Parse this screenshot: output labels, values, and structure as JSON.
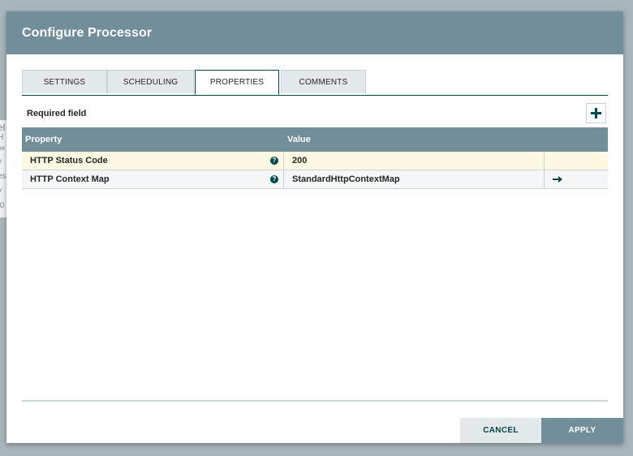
{
  "background": {
    "fragments": [
      "el",
      "H",
      "he",
      "y",
      "es",
      "y",
      ":0"
    ]
  },
  "dialog": {
    "title": "Configure Processor"
  },
  "tabs": [
    {
      "label": "SETTINGS",
      "active": false
    },
    {
      "label": "SCHEDULING",
      "active": false
    },
    {
      "label": "PROPERTIES",
      "active": true
    },
    {
      "label": "COMMENTS",
      "active": false
    }
  ],
  "properties": {
    "required_label": "Required field",
    "add_icon": "plus-icon",
    "columns": {
      "property": "Property",
      "value": "Value"
    },
    "rows": [
      {
        "name": "HTTP Status Code",
        "value": "200",
        "help_icon": "?",
        "action_icon": ""
      },
      {
        "name": "HTTP Context Map",
        "value": "StandardHttpContextMap",
        "help_icon": "?",
        "action_icon": "arrow-right-icon"
      }
    ]
  },
  "footer": {
    "cancel_label": "CANCEL",
    "apply_label": "APPLY"
  },
  "colors": {
    "header_bg": "#728e9b",
    "accent": "#004849",
    "required_row_bg": "#fdf8e2",
    "alt_row_bg": "#f4f6f7",
    "cancel_bg": "#e3e8eb"
  }
}
